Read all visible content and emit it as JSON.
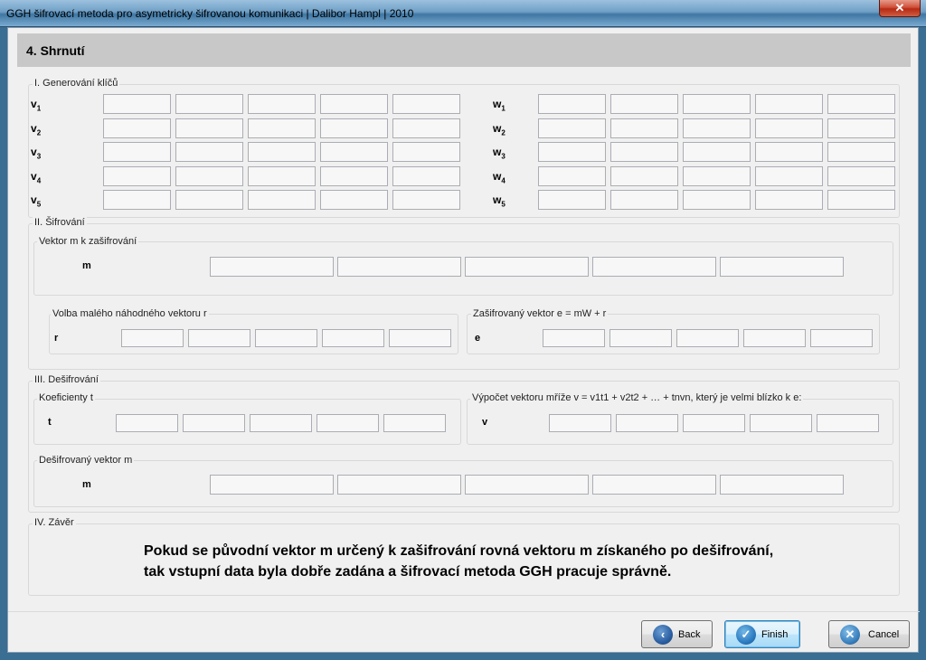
{
  "window": {
    "title": "GGH šifrovací metoda pro asymetricky šifrovanou komunikaci | Dalibor Hampl | 2010",
    "close_label": "✕"
  },
  "header": {
    "title": "4. Shrnutí"
  },
  "key_generation": {
    "label": "I. Generování klíčů",
    "v_rows": [
      {
        "name": "v",
        "sub": "1"
      },
      {
        "name": "v",
        "sub": "2"
      },
      {
        "name": "v",
        "sub": "3"
      },
      {
        "name": "v",
        "sub": "4"
      },
      {
        "name": "v",
        "sub": "5"
      }
    ],
    "w_rows": [
      {
        "name": "w",
        "sub": "1"
      },
      {
        "name": "w",
        "sub": "2"
      },
      {
        "name": "w",
        "sub": "3"
      },
      {
        "name": "w",
        "sub": "4"
      },
      {
        "name": "w",
        "sub": "5"
      }
    ]
  },
  "encryption": {
    "label": "II. Šifrování",
    "message": {
      "label": "Vektor m k zašifrování",
      "var": "m"
    },
    "random": {
      "label": "Volba malého náhodného vektoru r",
      "var": "r"
    },
    "encrypted": {
      "label": "Zašifrovaný vektor e = mW + r",
      "var": "e"
    }
  },
  "decryption": {
    "label": "III. Dešifrování",
    "coefficients": {
      "label": "Koeficienty t",
      "var": "t"
    },
    "lattice": {
      "label": "Výpočet vektoru mříže v = v1t1 + v2t2 + … + tnvn, který je velmi blízko k e:",
      "var": "v"
    },
    "decrypted": {
      "label": "Dešifrovaný vektor m",
      "var": "m"
    }
  },
  "conclusion": {
    "label": "IV. Závěr",
    "line1": "Pokud se původní vektor m určený k zašifrování rovná vektoru m získaného po dešifrování,",
    "line2": "tak vstupní data byla dobře zadána a šifrovací metoda GGH pracuje správně."
  },
  "buttons": {
    "back": "Back",
    "finish": "Finish",
    "cancel": "Cancel"
  },
  "colors": {
    "header_bg": "#c8c8c8",
    "window_bg": "#f0f0f0",
    "accent": "#3c7fb1"
  }
}
